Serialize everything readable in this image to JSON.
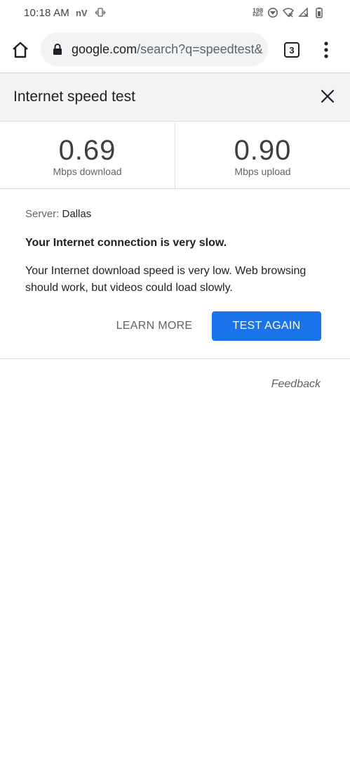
{
  "status_bar": {
    "time": "10:18 AM",
    "carrier": "nV",
    "net_speed_value": "198",
    "net_speed_unit": "KB/S",
    "icons": [
      "vibrate-icon",
      "data-saver-icon",
      "wifi-off-icon",
      "signal-off-icon",
      "battery-icon"
    ]
  },
  "browser": {
    "url_host": "google.com",
    "url_path": "/search?q=speedtest&",
    "tab_count": "3"
  },
  "speed_test": {
    "title": "Internet speed test",
    "download_value": "0.69",
    "download_label": "Mbps download",
    "upload_value": "0.90",
    "upload_label": "Mbps upload",
    "server_label": "Server: ",
    "server_name": "Dallas",
    "verdict": "Your Internet connection is very slow.",
    "explanation": "Your Internet download speed is very low. Web browsing should work, but videos could load slowly.",
    "learn_more_label": "LEARN MORE",
    "test_again_label": "TEST AGAIN",
    "feedback_label": "Feedback"
  },
  "colors": {
    "accent": "#1a73e8",
    "header_bg": "#f1f3f4"
  }
}
